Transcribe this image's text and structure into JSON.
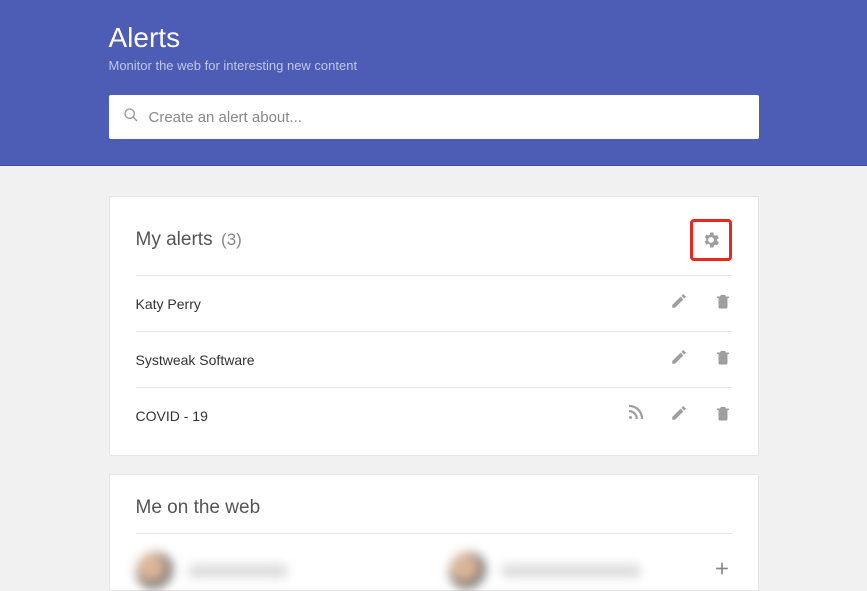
{
  "header": {
    "title": "Alerts",
    "subtitle": "Monitor the web for interesting new content",
    "search_placeholder": "Create an alert about..."
  },
  "my_alerts": {
    "title": "My alerts",
    "count": "(3)",
    "items": [
      {
        "name": "Katy Perry",
        "has_rss": false
      },
      {
        "name": "Systweak Software",
        "has_rss": false
      },
      {
        "name": "COVID - 19",
        "has_rss": true
      }
    ]
  },
  "me_on_web": {
    "title": "Me on the web"
  },
  "icons": {
    "gear": "gear-icon",
    "pencil": "pencil-icon",
    "trash": "trash-icon",
    "rss": "rss-icon",
    "plus": "plus-icon",
    "search": "search-icon"
  }
}
